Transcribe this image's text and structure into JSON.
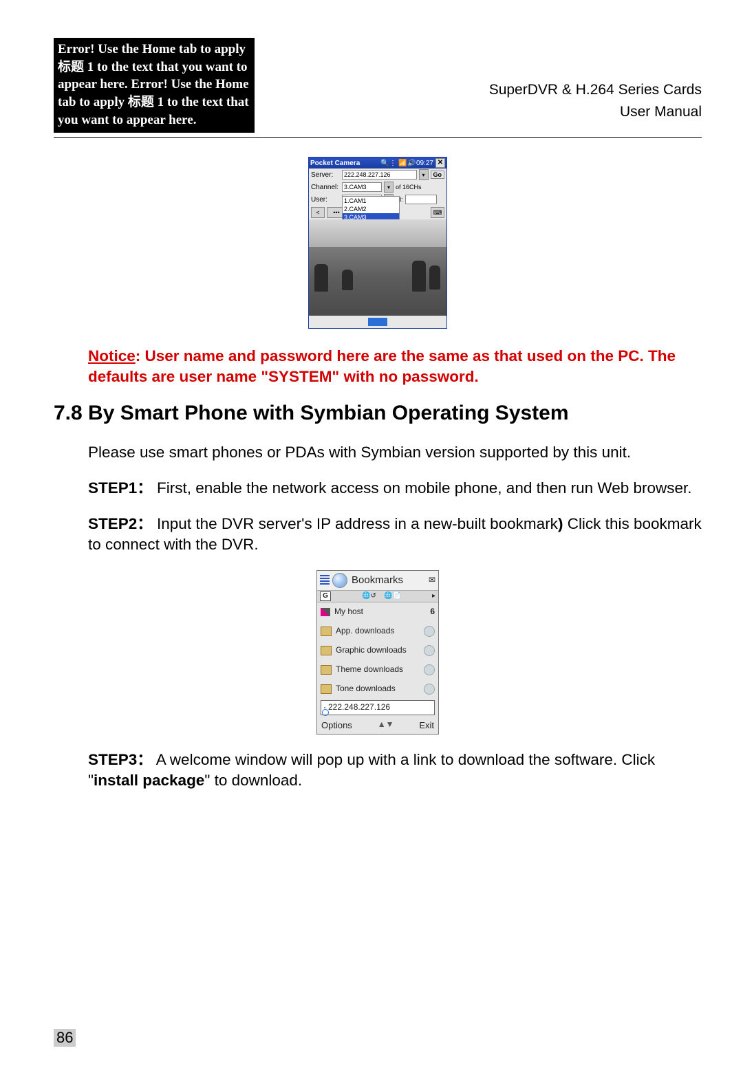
{
  "error_box": "Error! Use the Home tab to apply 标题 1 to the text that you want to appear here. Error! Use the Home tab to apply 标题 1 to the text that you want to appear here.",
  "header": {
    "line1": "SuperDVR & H.264 Series Cards",
    "line2": "User Manual"
  },
  "pocket": {
    "title": "Pocket Camera",
    "time": "09:27",
    "server_label": "Server:",
    "server_value": "222.248.227.126",
    "go": "Go",
    "channel_label": "Channel:",
    "channel_value": "3.CAM3",
    "ch_suffix": "of 16CHs",
    "user_label": "User:",
    "user_value": "",
    "pwd_label": "rd:",
    "options": {
      "a": "1.CAM1",
      "b": "2.CAM2",
      "c": "3.CAM3"
    },
    "nav_prev": "<",
    "nav_dots": "•••"
  },
  "notice": {
    "label": "Notice",
    "text": ": User name and password here are the same as that used on the PC. The defaults are user name \"SYSTEM\" with no password."
  },
  "section_title": "7.8  By Smart Phone with Symbian Operating System",
  "intro": "Please use smart phones or PDAs with Symbian version supported by this unit.",
  "step1": {
    "label": "STEP1：",
    "text": " First, enable the network access on mobile phone, and then run Web browser."
  },
  "step2": {
    "label": "STEP2：",
    "text_a": " Input the DVR server's IP address in a new-built bookmark",
    "paren": ")",
    "text_b": " Click this bookmark to connect with the DVR."
  },
  "symbian": {
    "title": "Bookmarks",
    "tab_g": "G",
    "tab_arrow": "▸",
    "rows": {
      "r0": {
        "label": "My host",
        "badge": "6"
      },
      "r1": {
        "label": "App. downloads"
      },
      "r2": {
        "label": "Graphic downloads"
      },
      "r3": {
        "label": "Theme downloads"
      },
      "r4": {
        "label": "Tone downloads"
      }
    },
    "input": "222.248.227.126",
    "options": "Options",
    "mid": "▲▼",
    "exit": "Exit"
  },
  "step3": {
    "label": "STEP3：",
    "text_a": " A welcome window will pop up with a link to download the software. Click \"",
    "bold": "install package",
    "text_b": "\" to download."
  },
  "page_number": "86"
}
